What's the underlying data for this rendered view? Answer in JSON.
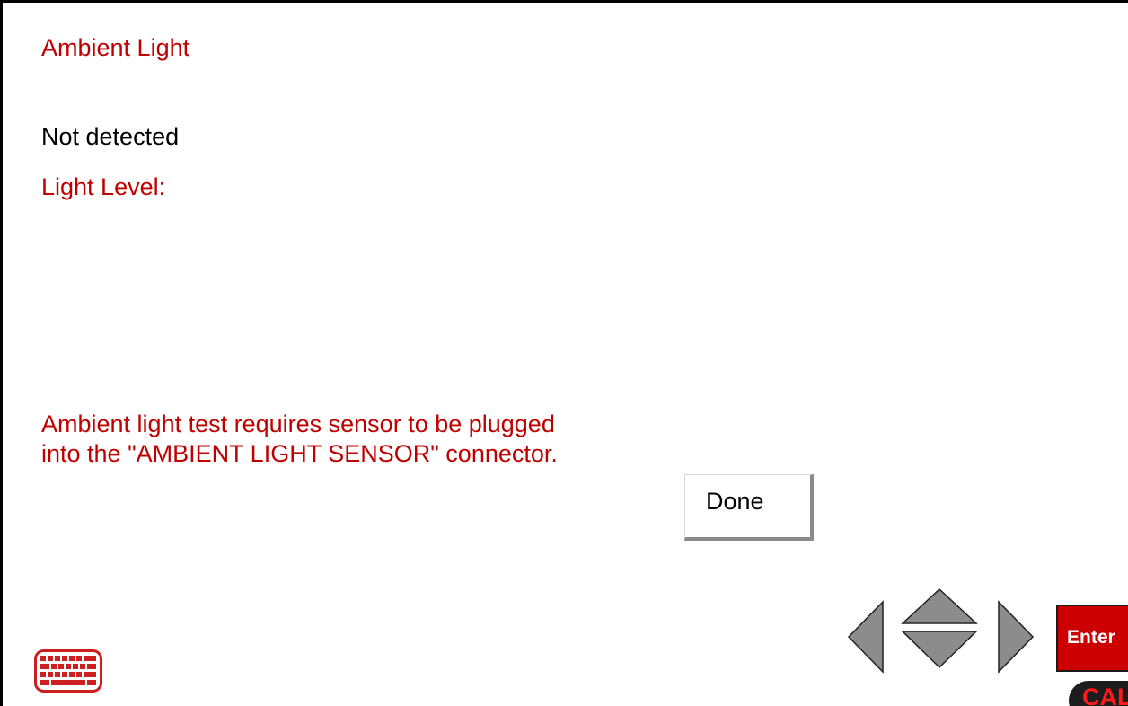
{
  "screen": {
    "title": "Ambient Light",
    "status_text": "Not detected",
    "level_label": "Light Level:",
    "message_line1": "Ambient light test requires sensor to be plugged",
    "message_line2": "into the \"AMBIENT LIGHT SENSOR\" connector."
  },
  "buttons": {
    "done_label": "Done",
    "enter_label": "Enter"
  },
  "badge": {
    "cal_label": "CAL"
  },
  "colors": {
    "accent_red": "#c00000",
    "enter_red": "#cc0000",
    "arrow_gray": "#8c8c8c"
  },
  "icons": {
    "keyboard": "keyboard-icon",
    "left": "arrow-left-icon",
    "up": "arrow-up-icon",
    "down": "arrow-down-icon",
    "right": "arrow-right-icon"
  }
}
